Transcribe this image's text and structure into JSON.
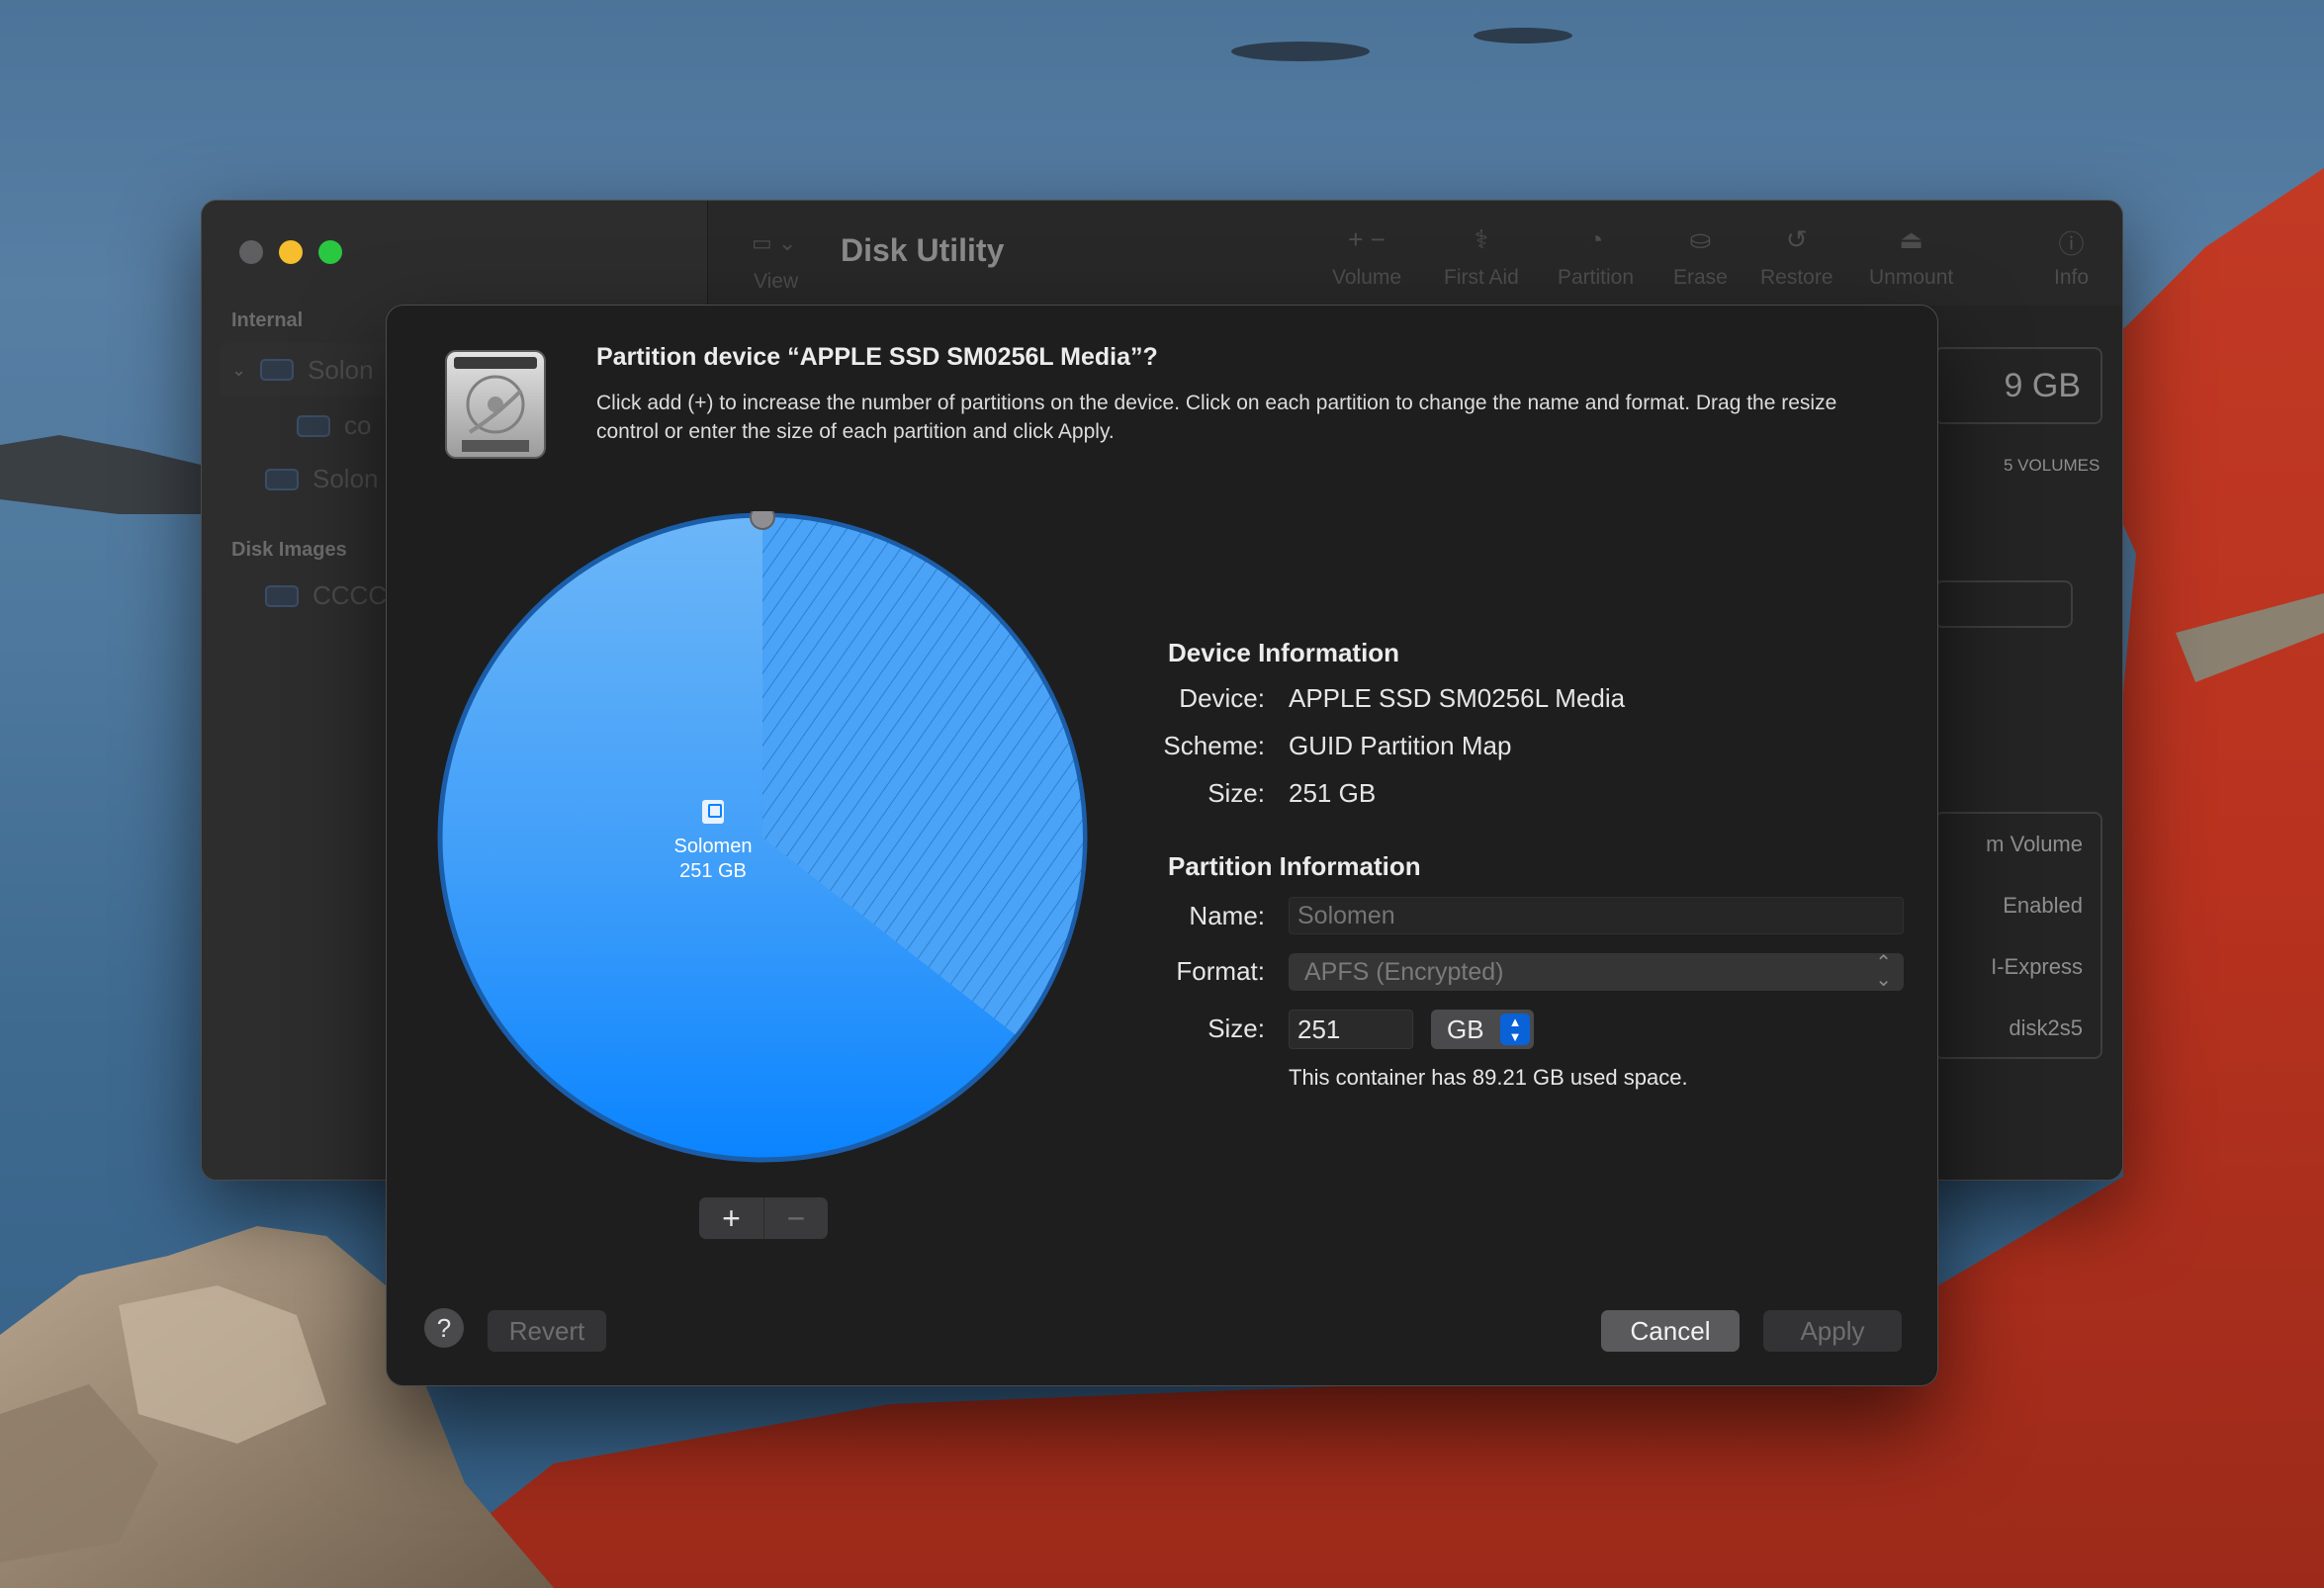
{
  "background_window": {
    "title": "Disk Utility",
    "view_label": "View",
    "sidebar": {
      "section_internal": "Internal",
      "items": [
        {
          "label": "Solon"
        },
        {
          "label": "co"
        },
        {
          "label": "Solon"
        }
      ],
      "section_disk_images": "Disk Images",
      "disk_image_item": "CCCC"
    },
    "toolbar": [
      {
        "label": "Volume",
        "icon": "plus-minus-icon"
      },
      {
        "label": "First Aid",
        "icon": "stethoscope-icon"
      },
      {
        "label": "Partition",
        "icon": "partition-icon"
      },
      {
        "label": "Erase",
        "icon": "erase-icon"
      },
      {
        "label": "Restore",
        "icon": "restore-icon"
      },
      {
        "label": "Unmount",
        "icon": "eject-icon"
      },
      {
        "label": "Info",
        "icon": "info-icon"
      }
    ],
    "right_panel": {
      "capacity": "9 GB",
      "volumes": "5 VOLUMES",
      "rows": [
        "m Volume",
        "Enabled",
        "I-Express",
        "disk2s5"
      ]
    }
  },
  "sheet": {
    "title": "Partition device “APPLE SSD SM0256L Media”?",
    "description": "Click add (+) to increase the number of partitions on the device. Click on each partition to change the name and format. Drag the resize control or enter the size of each partition and click Apply.",
    "pie": {
      "partition_name": "Solomen",
      "partition_size": "251 GB",
      "colors": {
        "fill": "#0a84ff",
        "used_hatch": "#5aa9f7",
        "border": "#1b5da8"
      }
    },
    "add_button": "+",
    "remove_button": "−",
    "device_information": {
      "heading": "Device Information",
      "device_label": "Device:",
      "device_value": "APPLE SSD SM0256L Media",
      "scheme_label": "Scheme:",
      "scheme_value": "GUID Partition Map",
      "size_label": "Size:",
      "size_value": "251 GB"
    },
    "partition_information": {
      "heading": "Partition Information",
      "name_label": "Name:",
      "name_placeholder": "Solomen",
      "format_label": "Format:",
      "format_value": "APFS (Encrypted)",
      "size_label": "Size:",
      "size_value": "251",
      "size_unit": "GB",
      "used_note": "This container has 89.21 GB used space."
    },
    "help_button": "?",
    "revert_button": "Revert",
    "cancel_button": "Cancel",
    "apply_button": "Apply"
  }
}
